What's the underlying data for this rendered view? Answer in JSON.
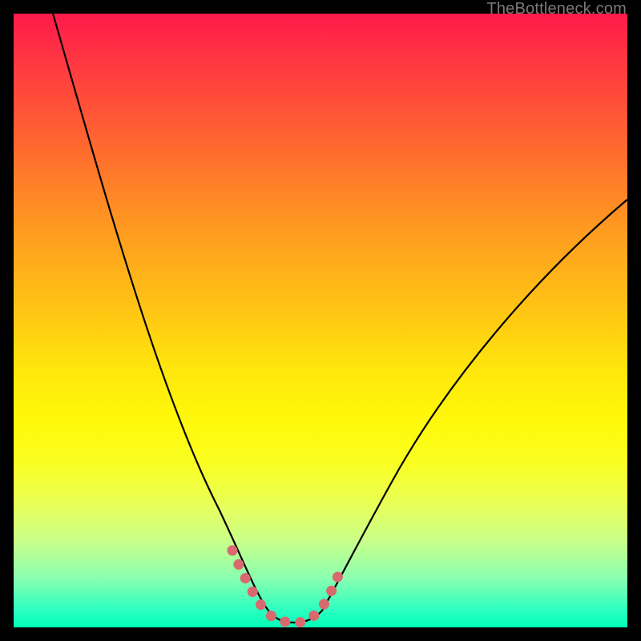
{
  "watermark": "TheBottleneck.com",
  "chart_data": {
    "type": "line",
    "title": "",
    "xlabel": "",
    "ylabel": "",
    "xlim": [
      0,
      100
    ],
    "ylim": [
      0,
      100
    ],
    "series": [
      {
        "name": "bottleneck-curve",
        "x": [
          6,
          10,
          14,
          18,
          22,
          26,
          30,
          33,
          36,
          38,
          40,
          42,
          44,
          46,
          48,
          50,
          54,
          58,
          63,
          68,
          74,
          80,
          86,
          92,
          100
        ],
        "y": [
          100,
          88,
          76,
          65,
          54,
          43,
          33,
          25,
          17,
          11,
          6,
          3,
          1,
          0.5,
          0.5,
          1,
          4,
          9,
          16,
          24,
          33,
          43,
          52,
          60,
          70
        ]
      },
      {
        "name": "optimal-region",
        "x": [
          36,
          38,
          40,
          42,
          44,
          46,
          48,
          50,
          52
        ],
        "y": [
          12,
          7,
          3.5,
          1.5,
          0.8,
          0.8,
          1.5,
          3,
          6
        ]
      }
    ],
    "colors": {
      "curve": "#000000",
      "optimal": "#d86a6f"
    }
  }
}
